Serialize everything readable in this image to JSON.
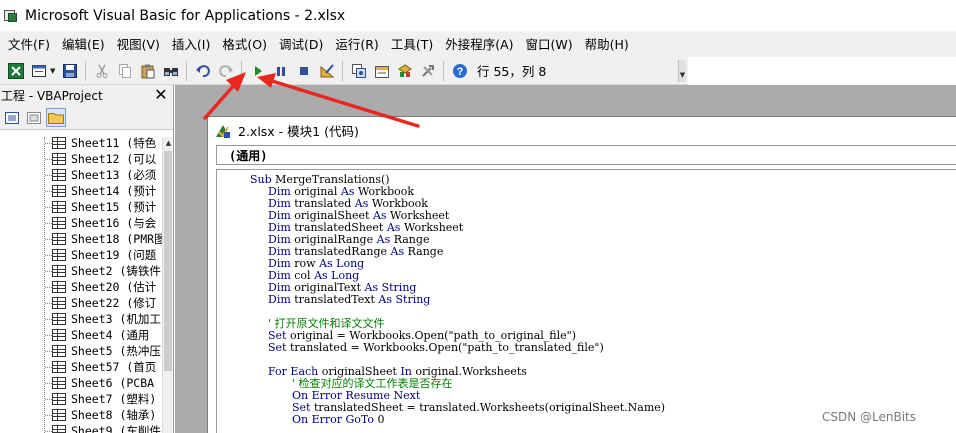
{
  "window": {
    "title": "Microsoft Visual Basic for Applications - 2.xlsx"
  },
  "menu": {
    "items": [
      "文件(F)",
      "编辑(E)",
      "视图(V)",
      "插入(I)",
      "格式(O)",
      "调试(D)",
      "运行(R)",
      "工具(T)",
      "外接程序(A)",
      "窗口(W)",
      "帮助(H)"
    ]
  },
  "toolbar": {
    "cursor_position": "行 55，列 8",
    "icons": [
      "view-excel",
      "insert-userform",
      "save",
      "cut",
      "copy",
      "paste",
      "find",
      "undo",
      "redo",
      "run",
      "break",
      "reset",
      "design-mode",
      "project-explorer",
      "properties-window",
      "object-browser",
      "toolbox",
      "help"
    ]
  },
  "project_explorer": {
    "title": "工程 - VBAProject",
    "close_symbol": "✕",
    "sheets": [
      "Sheet11 (特色",
      "Sheet12 (可以",
      "Sheet13 (必须",
      "Sheet14 (预计",
      "Sheet15 (预计",
      "Sheet16 (与会",
      "Sheet18 (PMR图",
      "Sheet19 (问题",
      "Sheet2 (铸铁件",
      "Sheet20 (估计",
      "Sheet22 (修订",
      "Sheet3 (机加工",
      "Sheet4 (通用",
      "Sheet5 (热冲压",
      "Sheet57 (首页",
      "Sheet6 (PCBA",
      "Sheet7 (塑料)",
      "Sheet8 (轴承)",
      "Sheet9 (车削件"
    ]
  },
  "code_window": {
    "title": "2.xlsx - 模块1 (代码)",
    "object_dropdown": "(通用)",
    "lines": [
      {
        "indent": 0,
        "parts": [
          [
            "kw",
            "Sub "
          ],
          [
            "tx",
            "MergeTranslations()"
          ]
        ]
      },
      {
        "indent": 1,
        "parts": [
          [
            "kw",
            "Dim "
          ],
          [
            "tx",
            "original "
          ],
          [
            "kw",
            "As "
          ],
          [
            "tx",
            "Workbook"
          ]
        ]
      },
      {
        "indent": 1,
        "parts": [
          [
            "kw",
            "Dim "
          ],
          [
            "tx",
            "translated "
          ],
          [
            "kw",
            "As "
          ],
          [
            "tx",
            "Workbook"
          ]
        ]
      },
      {
        "indent": 1,
        "parts": [
          [
            "kw",
            "Dim "
          ],
          [
            "tx",
            "originalSheet "
          ],
          [
            "kw",
            "As "
          ],
          [
            "tx",
            "Worksheet"
          ]
        ]
      },
      {
        "indent": 1,
        "parts": [
          [
            "kw",
            "Dim "
          ],
          [
            "tx",
            "translatedSheet "
          ],
          [
            "kw",
            "As "
          ],
          [
            "tx",
            "Worksheet"
          ]
        ]
      },
      {
        "indent": 1,
        "parts": [
          [
            "kw",
            "Dim "
          ],
          [
            "tx",
            "originalRange "
          ],
          [
            "kw",
            "As "
          ],
          [
            "tx",
            "Range"
          ]
        ]
      },
      {
        "indent": 1,
        "parts": [
          [
            "kw",
            "Dim "
          ],
          [
            "tx",
            "translatedRange "
          ],
          [
            "kw",
            "As "
          ],
          [
            "tx",
            "Range"
          ]
        ]
      },
      {
        "indent": 1,
        "parts": [
          [
            "kw",
            "Dim "
          ],
          [
            "tx",
            "row "
          ],
          [
            "kw",
            "As Long"
          ]
        ]
      },
      {
        "indent": 1,
        "parts": [
          [
            "kw",
            "Dim "
          ],
          [
            "tx",
            "col "
          ],
          [
            "kw",
            "As Long"
          ]
        ]
      },
      {
        "indent": 1,
        "parts": [
          [
            "kw",
            "Dim "
          ],
          [
            "tx",
            "originalText "
          ],
          [
            "kw",
            "As String"
          ]
        ]
      },
      {
        "indent": 1,
        "parts": [
          [
            "kw",
            "Dim "
          ],
          [
            "tx",
            "translatedText "
          ],
          [
            "kw",
            "As String"
          ]
        ]
      },
      {
        "indent": 0,
        "parts": []
      },
      {
        "indent": 1,
        "parts": [
          [
            "cm",
            "' 打开原文件和译文文件"
          ]
        ]
      },
      {
        "indent": 1,
        "parts": [
          [
            "kw",
            "Set "
          ],
          [
            "tx",
            "original = Workbooks.Open(\"path_to_original_file\")"
          ]
        ]
      },
      {
        "indent": 1,
        "parts": [
          [
            "kw",
            "Set "
          ],
          [
            "tx",
            "translated = Workbooks.Open(\"path_to_translated_file\")"
          ]
        ]
      },
      {
        "indent": 0,
        "parts": []
      },
      {
        "indent": 1,
        "parts": [
          [
            "kw",
            "For Each "
          ],
          [
            "tx",
            "originalSheet "
          ],
          [
            "kw",
            "In "
          ],
          [
            "tx",
            "original.Worksheets"
          ]
        ]
      },
      {
        "indent": 2,
        "parts": [
          [
            "cm",
            "' 检查对应的译文工作表是否存在"
          ]
        ]
      },
      {
        "indent": 2,
        "parts": [
          [
            "kw",
            "On Error Resume Next"
          ]
        ]
      },
      {
        "indent": 2,
        "parts": [
          [
            "kw",
            "Set "
          ],
          [
            "tx",
            "translatedSheet = translated.Worksheets(originalSheet.Name)"
          ]
        ]
      },
      {
        "indent": 2,
        "parts": [
          [
            "kw",
            "On Error GoTo "
          ],
          [
            "tx",
            "0"
          ]
        ]
      }
    ]
  },
  "watermark": "CSDN @LenBits",
  "colors": {
    "keyword": "#00007f",
    "comment": "#008000",
    "annotation_arrow": "#e8271f",
    "mdi_background": "#ababab"
  }
}
